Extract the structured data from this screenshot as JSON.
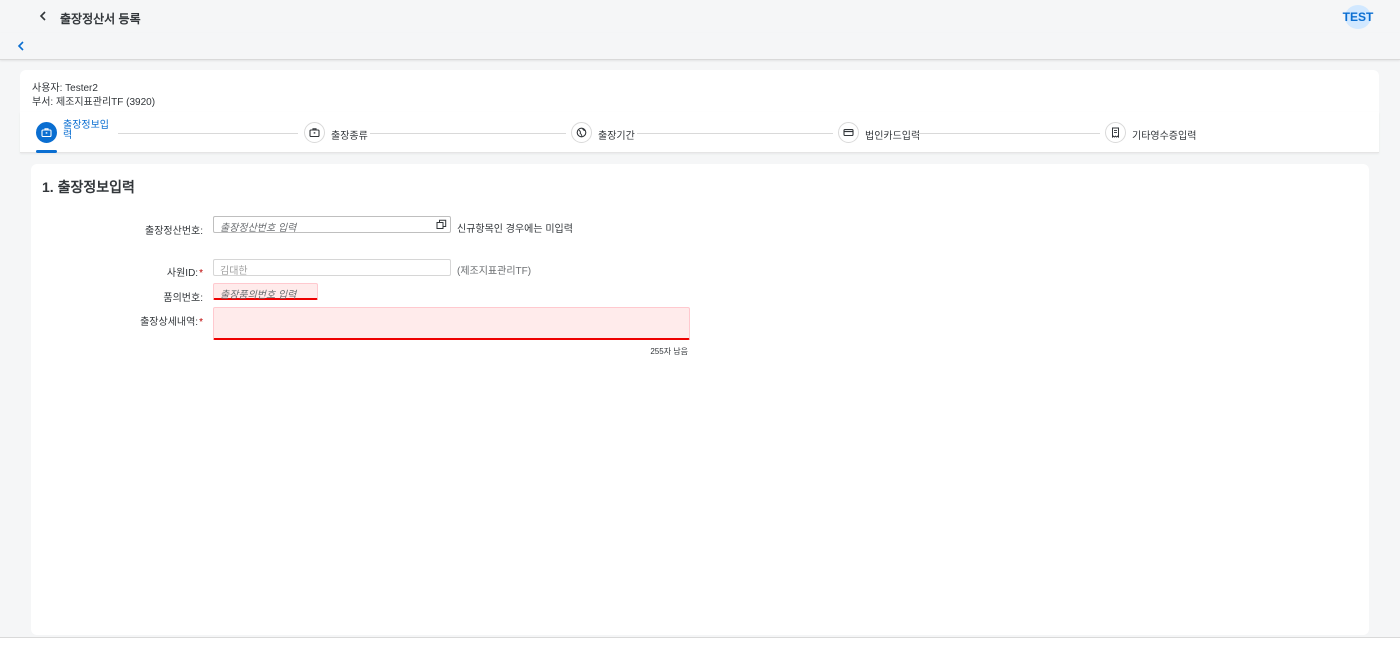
{
  "shell": {
    "title": "출장정산서 등록",
    "avatar_text": "TEST"
  },
  "header": {
    "user": "사용자: Tester2",
    "department": "부서: 제조지표관리TF (3920)"
  },
  "wizard": {
    "steps": [
      {
        "label": "출장정보입력",
        "icon": "briefcase-icon",
        "active": true
      },
      {
        "label": "출장종류",
        "icon": "briefcase-icon",
        "active": false
      },
      {
        "label": "출장기간",
        "icon": "globe-icon",
        "active": false
      },
      {
        "label": "법인카드입력",
        "icon": "credit-card-icon",
        "active": false
      },
      {
        "label": "기타영수증입력",
        "icon": "receipt-icon",
        "active": false
      }
    ]
  },
  "form": {
    "section_title": "1. 출장정보입력",
    "settlement_no": {
      "label": "출장정산번호:",
      "placeholder": "출장정산번호 입력",
      "hint": "신규항목인 경우에는 미입력"
    },
    "employee_id": {
      "label": "사원ID:",
      "value": "김대한",
      "hint": "(제조지표관리TF)"
    },
    "approval_no": {
      "label": "품의번호:",
      "placeholder": "출장품의번호 입력"
    },
    "details": {
      "label": "출장상세내역:",
      "counter": "255자 남음"
    }
  },
  "colors": {
    "accent": "#0a6ed1",
    "error": "#ee0000",
    "error_bg": "#ffebeb"
  }
}
